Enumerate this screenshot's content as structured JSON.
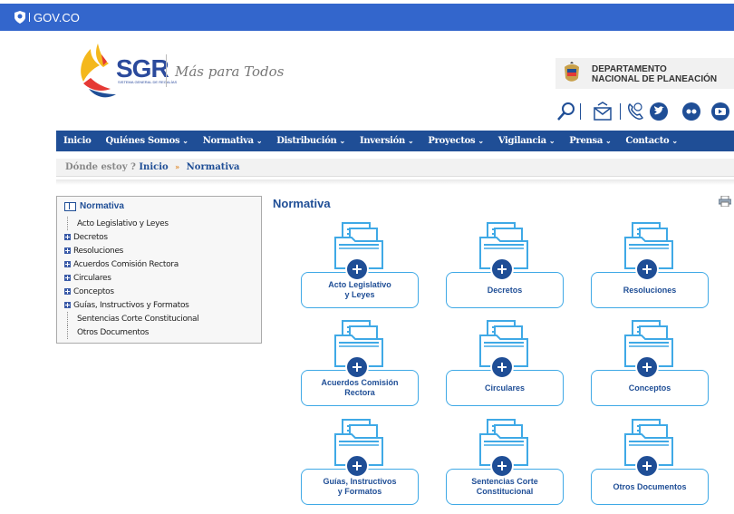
{
  "gov_bar": {
    "label": "GOV.CO"
  },
  "header": {
    "logo_text": "SGR",
    "logo_subtext": "SISTEMA GENERAL DE REGALÍAS",
    "tagline": "Más para Todos",
    "dnp_line1": "DEPARTAMENTO",
    "dnp_line2": "NACIONAL DE PLANEACIÓN"
  },
  "nav": {
    "items": [
      {
        "label": "Inicio",
        "dropdown": false
      },
      {
        "label": "Quiénes Somos",
        "dropdown": true
      },
      {
        "label": "Normativa",
        "dropdown": true
      },
      {
        "label": "Distribución",
        "dropdown": true
      },
      {
        "label": "Inversión",
        "dropdown": true
      },
      {
        "label": "Proyectos",
        "dropdown": true
      },
      {
        "label": "Vigilancia",
        "dropdown": true
      },
      {
        "label": "Prensa",
        "dropdown": true
      },
      {
        "label": "Contacto",
        "dropdown": true
      }
    ],
    "chevron": "⌄"
  },
  "breadcrumb": {
    "prefix": "Dónde estoy ?",
    "home": "Inicio",
    "separator": "»",
    "current": "Normativa"
  },
  "sidebar": {
    "root": "Normativa",
    "items": [
      {
        "label": "Acto Legislativo y Leyes",
        "expandable": false
      },
      {
        "label": "Decretos",
        "expandable": true
      },
      {
        "label": "Resoluciones",
        "expandable": true
      },
      {
        "label": "Acuerdos Comisión Rectora",
        "expandable": true
      },
      {
        "label": "Circulares",
        "expandable": true
      },
      {
        "label": "Conceptos",
        "expandable": true
      },
      {
        "label": "Guías, Instructivos y Formatos",
        "expandable": true
      },
      {
        "label": "Sentencias Corte Constitucional",
        "expandable": false
      },
      {
        "label": "Otros Documentos",
        "expandable": false
      }
    ]
  },
  "main": {
    "title": "Normativa",
    "cards": [
      {
        "label": "Acto Legislativo\ny Leyes"
      },
      {
        "label": "Decretos"
      },
      {
        "label": "Resoluciones"
      },
      {
        "label": "Acuerdos Comisión\nRectora"
      },
      {
        "label": "Circulares"
      },
      {
        "label": "Conceptos"
      },
      {
        "label": "Guías, Instructivos\ny Formatos"
      },
      {
        "label": "Sentencias Corte\nConstitucional"
      },
      {
        "label": "Otros Documentos"
      }
    ]
  },
  "colors": {
    "gov_blue": "#3366cc",
    "nav_blue": "#1f4e96",
    "card_border": "#3fa9e6",
    "folder_blue": "#3fa9e6"
  }
}
